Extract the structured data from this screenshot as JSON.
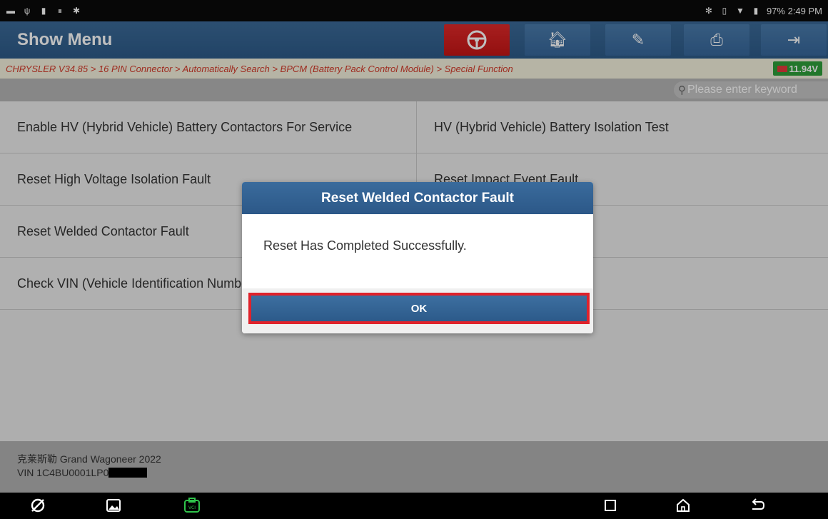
{
  "status_bar": {
    "right_text": "97% 2:49 PM"
  },
  "header": {
    "title": "Show Menu",
    "buttons": [
      "steering-wheel-icon",
      "home-icon",
      "edit-icon",
      "print-icon",
      "exit-icon"
    ]
  },
  "breadcrumb": {
    "path": "CHRYSLER V34.85 > 16 PIN Connector > Automatically Search > BPCM (Battery Pack Control Module) > Special Function",
    "battery_voltage": "11.94V"
  },
  "search": {
    "placeholder": "Please enter keyword"
  },
  "menu": {
    "items": [
      "Enable HV (Hybrid Vehicle) Battery Contactors For Service",
      "HV (Hybrid Vehicle) Battery Isolation Test",
      "Reset High Voltage Isolation Fault",
      "Reset Impact Event Fault",
      "Reset Welded Contactor Fault",
      "",
      "Check VIN (Vehicle Identification Number)",
      ""
    ]
  },
  "footer": {
    "vehicle": "克莱斯勒 Grand Wagoneer 2022",
    "vin_prefix": "VIN 1C4BU0001LP0"
  },
  "dialog": {
    "title": "Reset Welded Contactor Fault",
    "message": "Reset Has Completed Successfully.",
    "ok_label": "OK"
  },
  "colors": {
    "header_blue": "#2d5a88",
    "highlight_red": "#e0222b",
    "breadcrumb_red": "#d33a2a",
    "battery_green": "#2e9f3a"
  }
}
